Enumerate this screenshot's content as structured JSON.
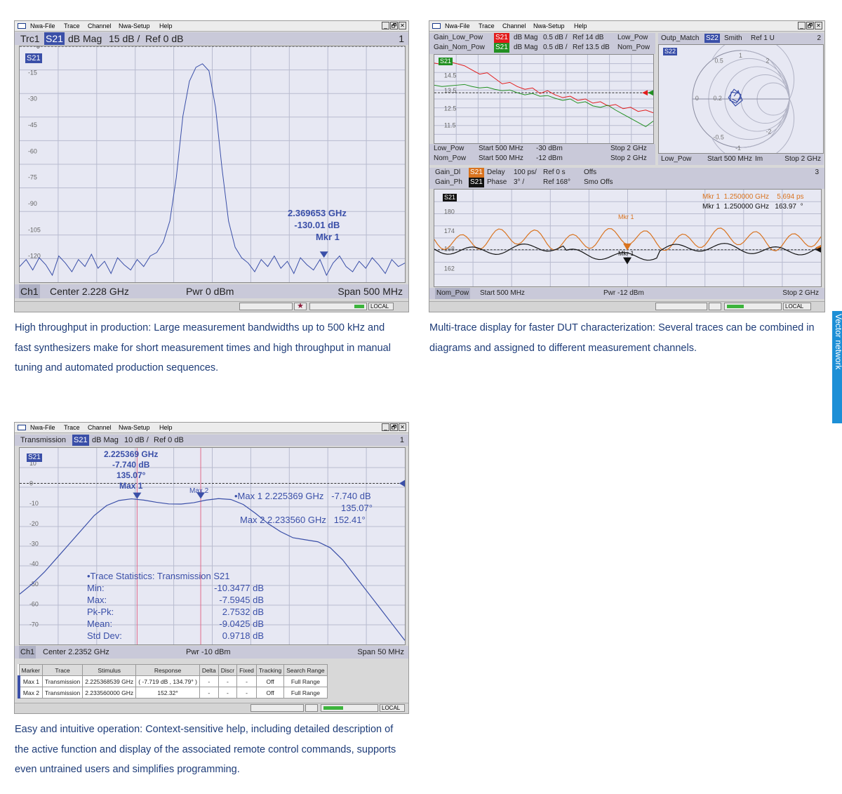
{
  "menu": [
    "Nwa-File",
    "Trace",
    "Channel",
    "Nwa-Setup",
    "Help"
  ],
  "menu_buttons": [
    "_",
    "🗗",
    "✕"
  ],
  "win1": {
    "header": {
      "trace": "Trc1",
      "param": "S21",
      "format": "dB Mag",
      "scale": "15 dB /",
      "ref": "Ref 0 dB",
      "num": "1"
    },
    "trace_tag": "S21",
    "y_ticks": [
      "-15",
      "-30",
      "-45",
      "-60",
      "-75",
      "-90",
      "-105",
      "-120"
    ],
    "ref_tick": "0",
    "marker": {
      "freq": "2.369653 GHz",
      "value": "-130.01 dB",
      "name": "Mkr 1"
    },
    "footer": {
      "channel": "Ch1",
      "center": "Center  2.228 GHz",
      "power": "Pwr  0 dBm",
      "span": "Span  500 MHz"
    },
    "status": "LOCAL",
    "chart_data": {
      "type": "line",
      "xlabel": "",
      "ylabel": "",
      "ylim": [
        -135,
        0
      ],
      "series": [
        {
          "values": [
            -126,
            -122,
            -128,
            -121,
            -125,
            -131,
            -120,
            -124,
            -129,
            -122,
            -126,
            -119,
            -127,
            -123,
            -130,
            -121,
            -125,
            -128,
            -122,
            -126,
            -120,
            -118,
            -112,
            -100,
            -75,
            -40,
            -20,
            -12,
            -10,
            -14,
            -35,
            -70,
            -100,
            -115,
            -121,
            -124,
            -129,
            -122,
            -126,
            -120,
            -127,
            -123,
            -130,
            -121,
            -125,
            -128,
            -122,
            -131,
            -124,
            -120,
            -126,
            -129,
            -123,
            -127,
            -121,
            -125,
            -130,
            -122,
            -126,
            -124
          ]
        }
      ]
    }
  },
  "win2": {
    "top_left_header": [
      {
        "name": "Gain_Low_Pow",
        "param": "S21",
        "format": "dB Mag",
        "scale": "0.5 dB /",
        "ref": "Ref 14 dB",
        "ch": "Low_Pow",
        "color": "#e21c1c"
      },
      {
        "name": "Gain_Nom_Pow",
        "param": "S21",
        "format": "dB Mag",
        "scale": "0.5 dB /",
        "ref": "Ref 13.5 dB",
        "ch": "Nom_Pow",
        "color": "#229022"
      }
    ],
    "top_left_tag": "S21",
    "top_left_ticks": [
      "14.5",
      "13.5",
      "12.5",
      "11.5"
    ],
    "top_left_footer": [
      {
        "ch": "Low_Pow",
        "start": "Start  500 MHz",
        "pwr": "-30 dBm",
        "stop": "Stop  2 GHz"
      },
      {
        "ch": "Nom_Pow",
        "start": "Start  500 MHz",
        "pwr": "-12 dBm",
        "stop": "Stop  2 GHz"
      }
    ],
    "smith_header": {
      "name": "Outp_Match",
      "param": "S22",
      "format": "Smith",
      "ref": "Ref 1 U",
      "num": "2"
    },
    "smith_tag": "S22",
    "smith_labels": [
      "1",
      "0.5",
      "2",
      "0",
      "0.2",
      "-0.5",
      "-2",
      "-1"
    ],
    "smith_footer": {
      "ch": "Low_Pow",
      "start": "Start  500 MHz",
      "im": "Im",
      "stop": "Stop  2 GHz"
    },
    "bottom_header": [
      {
        "name": "Gain_Dl",
        "param": "S21",
        "format": "Delay",
        "scale": "100 ps/",
        "ref": "Ref 0 s",
        "extra": "Offs",
        "color": "#d9731f"
      },
      {
        "name": "Gain_Ph",
        "param": "S21",
        "format": "Phase",
        "scale": "3° /",
        "ref": "Ref 168°",
        "extra": "Smo Offs",
        "color": "#111111"
      }
    ],
    "bottom_num": "3",
    "bottom_tag": "S21",
    "bottom_ticks": [
      "180",
      "174",
      "168",
      "162"
    ],
    "bottom_markers": [
      {
        "name": "Mkr 1",
        "freq": "1.250000 GHz",
        "value": "5.694",
        "unit": "ps",
        "color": "#d9731f"
      },
      {
        "name": "Mkr 1",
        "freq": "1.250000 GHz",
        "value": "163.97",
        "unit": "°",
        "color": "#111111"
      }
    ],
    "bottom_mkr_labels": [
      "Mkr 1",
      "Mkr 1"
    ],
    "bottom_footer": {
      "ch": "Nom_Pow",
      "start": "Start  500 MHz",
      "pwr": "Pwr  -12 dBm",
      "stop": "Stop  2 GHz"
    },
    "status": "LOCAL"
  },
  "win3": {
    "header": {
      "name": "Transmission",
      "param": "S21",
      "format": "dB Mag",
      "scale": "10 dB /",
      "ref": "Ref 0 dB",
      "num": "1"
    },
    "trace_tag": "S21",
    "y_ticks": [
      "10",
      "0",
      "-10",
      "-20",
      "-30",
      "-40",
      "-50",
      "-60",
      "-70"
    ],
    "marker1": {
      "freq": "2.225369 GHz",
      "value": "-7.740 dB",
      "phase": "135.07°",
      "name": "Max 1"
    },
    "marker2_label": "Max 2",
    "marker_info": [
      {
        "name": "•Max 1",
        "freq": "2.225369 GHz",
        "value": "-7.740 dB",
        "phase": "135.07°"
      },
      {
        "name": "Max 2",
        "freq": "2.233560 GHz",
        "value": "152.41°"
      }
    ],
    "stats": {
      "title": "•Trace Statistics: Transmission  S21",
      "rows": [
        [
          "Min:",
          "-10.3477 dB"
        ],
        [
          "Max:",
          "-7.5945 dB"
        ],
        [
          "Pk-Pk:",
          "2.7532 dB"
        ],
        [
          "Mean:",
          "-9.0425 dB"
        ],
        [
          "Std Dev:",
          "0.9718 dB"
        ]
      ]
    },
    "footer": {
      "channel": "Ch1",
      "center": "Center  2.2352 GHz",
      "power": "Pwr  -10 dBm",
      "span": "Span  50 MHz"
    },
    "table_headers": [
      "Marker",
      "Trace",
      "Stimulus",
      "Response",
      "Delta",
      "Discr",
      "Fixed",
      "Tracking",
      "Search Range"
    ],
    "table_rows": [
      [
        "Max 1",
        "Transmission",
        "2.225368539 GHz",
        "( -7.719 dB , 134.79° )",
        "-",
        "-",
        "-",
        "Off",
        "Full Range"
      ],
      [
        "Max 2",
        "Transmission",
        "2.233560000 GHz",
        "152.32°",
        "-",
        "-",
        "-",
        "Off",
        "Full Range"
      ]
    ],
    "status": "LOCAL",
    "chart_data": {
      "type": "line",
      "xlabel": "",
      "ylabel": "",
      "ylim": [
        -75,
        15
      ],
      "series": [
        {
          "values": [
            -55,
            -50,
            -44,
            -37,
            -30,
            -23,
            -16,
            -11,
            -8.5,
            -7.7,
            -8.3,
            -9.4,
            -10.2,
            -10.3,
            -9.6,
            -8.3,
            -7.6,
            -8,
            -10.5,
            -15,
            -20,
            -24,
            -27,
            -28,
            -29,
            -32,
            -38,
            -46,
            -54,
            -62,
            -70,
            -78
          ]
        }
      ]
    }
  },
  "captions": {
    "c1": [
      "High throughput in production: Large measurement bandwidths up to 500 kHz and",
      "fast synthesizers make for short measurement times and high throughput in manual",
      "tuning and automated production sequences."
    ],
    "c2": [
      "Multi-trace display for faster DUT characterization: Several traces can be combined in",
      "diagrams and assigned to different measurement channels."
    ],
    "c3": [
      "Easy and intuitive operation: Context-sensitive help, including detailed description of",
      "the active function and display of the associated remote control commands, supports",
      "even untrained users and simplifies programming."
    ]
  },
  "side_tab": "Vector network",
  "colors": {
    "trace_blue": "#3a4fa8",
    "caption_blue": "#1e3c78",
    "tab_blue": "#1d8fd6",
    "red": "#e21c1c",
    "green": "#229022",
    "orange": "#d9731f"
  }
}
